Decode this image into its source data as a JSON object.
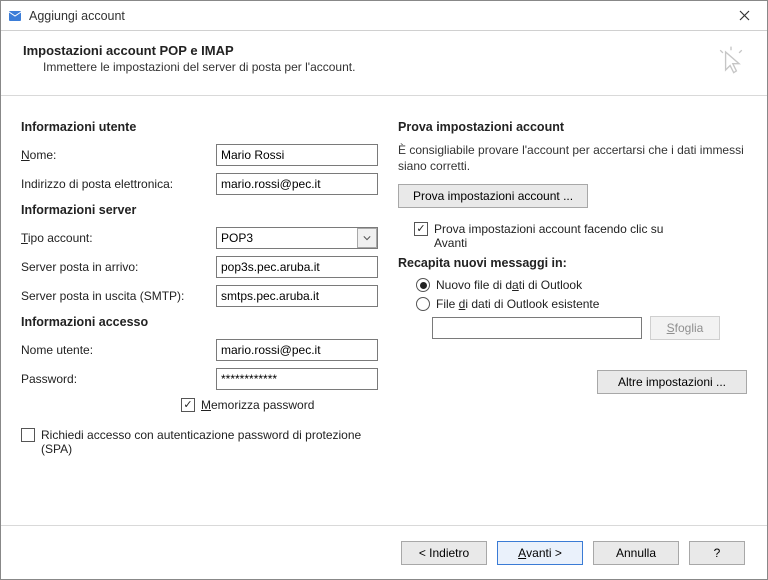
{
  "titlebar": {
    "title": "Aggiungi account"
  },
  "header": {
    "title": "Impostazioni account POP e IMAP",
    "subtitle": "Immettere le impostazioni del server di posta per l'account."
  },
  "sections": {
    "user_info_title": "Informazioni utente",
    "server_info_title": "Informazioni server",
    "access_info_title": "Informazioni accesso"
  },
  "user": {
    "name_label_pre": "N",
    "name_label_post": "ome:",
    "name_value": "Mario Rossi",
    "email_label": "Indirizzo di posta elettronica:",
    "email_value": "mario.rossi@pec.it"
  },
  "server": {
    "type_label_pre": "T",
    "type_label_post": "ipo account:",
    "type_value": "POP3",
    "incoming_label": "Server posta in arrivo:",
    "incoming_value": "pop3s.pec.aruba.it",
    "outgoing_label": "Server posta in uscita (SMTP):",
    "outgoing_value": "smtps.pec.aruba.it"
  },
  "access": {
    "username_label": "Nome utente:",
    "username_value": "mario.rossi@pec.it",
    "password_label": "Password:",
    "password_value": "************",
    "remember_pre": "M",
    "remember_post": "emorizza password",
    "spa_label": "Richiedi accesso con autenticazione password di protezione (SPA)"
  },
  "right": {
    "test_title": "Prova impostazioni account",
    "test_desc": "È consigliabile provare l'account per accertarsi che i dati immessi siano corretti.",
    "test_button": "Prova impostazioni account ...",
    "auto_test_check": "Prova impostazioni account facendo clic su Avanti",
    "deliver_title": "Recapita nuovi messaggi in:",
    "deliver_new_pre": "Nuovo file di d",
    "deliver_new_ul": "a",
    "deliver_new_post": "ti di Outlook",
    "deliver_existing_pre": "File ",
    "deliver_existing_ul": "d",
    "deliver_existing_post": "i dati di Outlook esistente",
    "browse_button_pre": "S",
    "browse_button_post": "foglia",
    "more_button": "Altre impostazioni ..."
  },
  "footer": {
    "back": "< Indietro",
    "next_pre": "A",
    "next_post": "vanti >",
    "cancel": "Annulla",
    "help": "?"
  }
}
